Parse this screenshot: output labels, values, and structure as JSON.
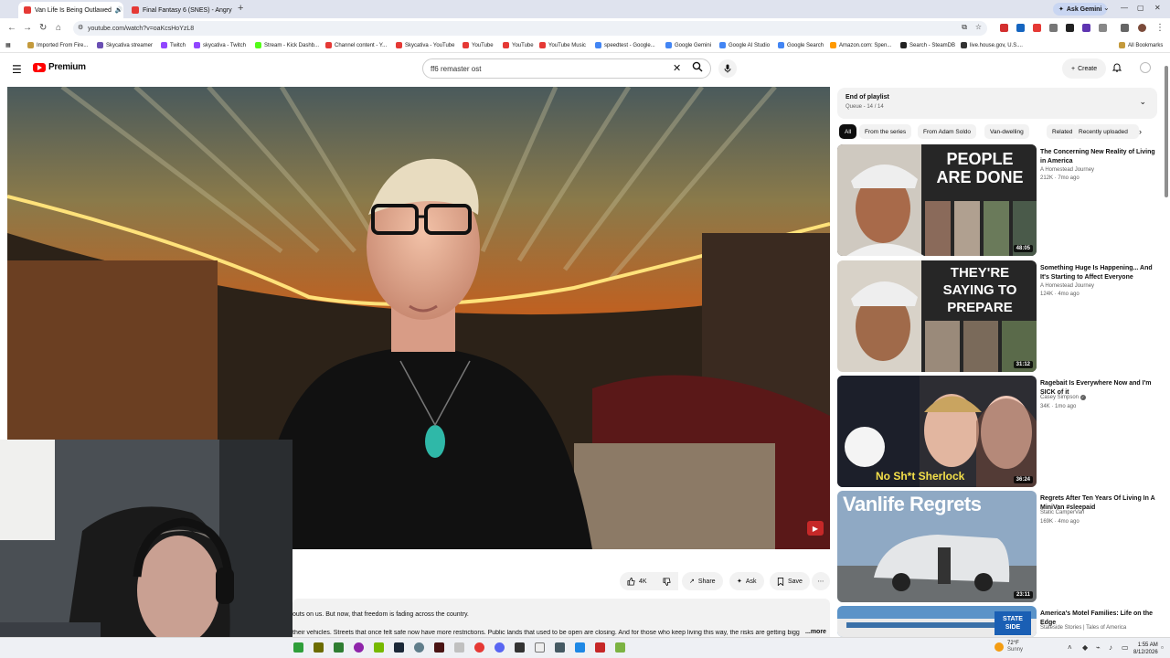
{
  "browser": {
    "tabs": [
      {
        "title": "Van Life Is Being Outlawed",
        "active": true
      },
      {
        "title": "Final Fantasy 6 (SNES) - Angry",
        "active": false
      }
    ],
    "new_tab": "+",
    "ask_gemini": "Ask Gemini",
    "address": "youtube.com/watch?v=oaKcsHoYzL8",
    "bookmarks": [
      {
        "label": "Imported From Fire...",
        "color": "#c49a3c"
      },
      {
        "label": "Skycativa streamer",
        "color": "#6a4fb3"
      },
      {
        "label": "Twitch",
        "color": "#9146ff"
      },
      {
        "label": "skycativa - Twitch",
        "color": "#9146ff"
      },
      {
        "label": "Stream - Kick Dashb...",
        "color": "#53fc18"
      },
      {
        "label": "Channel content - Y...",
        "color": "#e53935"
      },
      {
        "label": "Skycativa - YouTube",
        "color": "#e53935"
      },
      {
        "label": "YouTube",
        "color": "#e53935"
      },
      {
        "label": "YouTube",
        "color": "#e53935"
      },
      {
        "label": "YouTube Music",
        "color": "#e53935"
      },
      {
        "label": "speedtest - Google...",
        "color": "#4285f4"
      },
      {
        "label": "Google Gemini",
        "color": "#4285f4"
      },
      {
        "label": "Google AI Studio",
        "color": "#4285f4"
      },
      {
        "label": "Google Search",
        "color": "#4285f4"
      },
      {
        "label": "Amazon.com: Spen...",
        "color": "#ff9900"
      },
      {
        "label": "Search - SteamDB",
        "color": "#222222"
      },
      {
        "label": "live.house.gov, U.S....",
        "color": "#333333"
      }
    ],
    "all_bookmarks": "All Bookmarks"
  },
  "youtube": {
    "logo_text": "Premium",
    "search_value": "ff6 remaster ost",
    "create_label": "Create",
    "actions": {
      "like_count": "4K",
      "share": "Share",
      "ask": "Ask",
      "save": "Save"
    },
    "description": {
      "line1": "outs on us. But now, that freedom is fading across the country.",
      "line2": "their vehicles. Streets that once felt safe now have more restrictions. Public lands that used to be open are closing. And for those who keep living this way, the risks are getting bigg",
      "more": "...more"
    },
    "playlist": {
      "title": "End of playlist",
      "subtitle": "Queue - 14 / 14"
    },
    "chips": [
      "All",
      "From the series",
      "From Adam Soldo",
      "Van-dwelling",
      "Related",
      "Recently uploaded"
    ],
    "recommendations": [
      {
        "title": "The Concerning New Reality of Living in America",
        "channel": "A Homestead Journey",
        "meta": "212K · 7mo ago",
        "duration": "48:05",
        "thumb_text": "PEOPLE ARE DONE",
        "verified": false
      },
      {
        "title": "Something Huge Is Happening... And It's Starting to Affect Everyone",
        "channel": "A Homestead Journey",
        "meta": "124K · 4mo ago",
        "duration": "31:12",
        "thumb_text": "THEY'RE SAYING TO PREPARE",
        "verified": false
      },
      {
        "title": "Ragebait Is Everywhere Now and I'm SICK of it",
        "channel": "Casey Simpson",
        "meta": "34K · 1mo ago",
        "duration": "36:24",
        "thumb_text": "No Sh*t Sherlock",
        "verified": true
      },
      {
        "title": "Regrets After Ten Years Of Living In A MiniVan #sleepaid",
        "channel": "Static CamperVan",
        "meta": "169K · 4mo ago",
        "duration": "23:11",
        "thumb_text": "Vanlife Regrets",
        "verified": false
      },
      {
        "title": "America's Motel Families: Life on the Edge",
        "channel": "Stateside Stories | Tales of America",
        "meta": "",
        "duration": "",
        "thumb_text": "STATE SIDE",
        "verified": false
      }
    ]
  },
  "taskbar": {
    "weather_temp": "72°F",
    "weather_cond": "Sunny",
    "time": "1:55 AM",
    "date": "8/12/2026"
  }
}
